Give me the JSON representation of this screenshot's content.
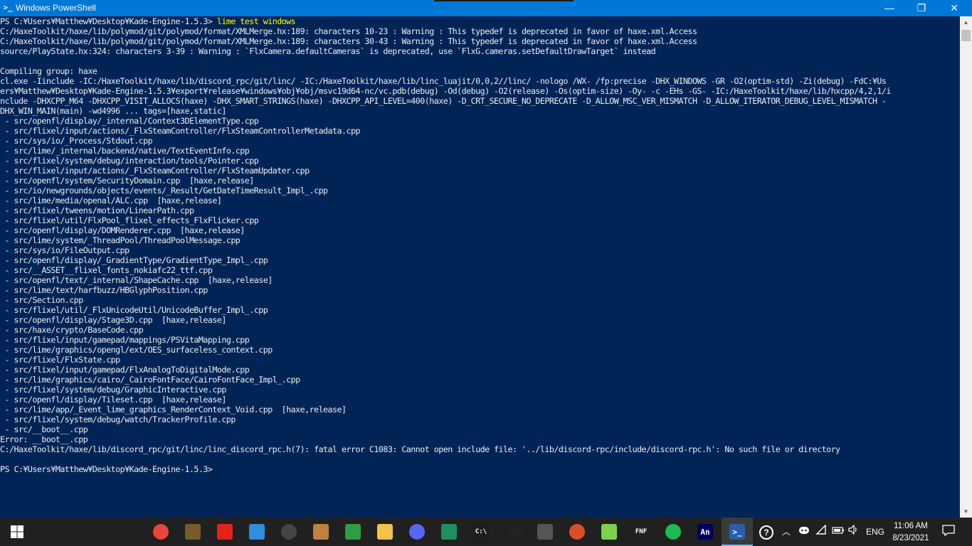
{
  "window": {
    "title": "Windows PowerShell",
    "minimize_glyph": "—",
    "maximize_glyph": "❐",
    "close_glyph": "✕",
    "app_icon_glyph": ">_"
  },
  "console": {
    "prompt": "PS C:¥Users¥Matthew¥Desktop¥Kade-Engine-1.5.3> ",
    "command": "lime test windows",
    "lines": [
      "C:/HaxeToolkit/haxe/lib/polymod/git/polymod/format/XMLMerge.hx:189: characters 10-23 : Warning : This typedef is deprecated in favor of haxe.xml.Access",
      "C:/HaxeToolkit/haxe/lib/polymod/git/polymod/format/XMLMerge.hx:189: characters 30-43 : Warning : This typedef is deprecated in favor of haxe.xml.Access",
      "source/PlayState.hx:324: characters 3-39 : Warning : `FlxCamera.defaultCameras` is deprecated, use `FlxG.cameras.setDefaultDrawTarget` instead",
      "",
      "Compiling group: haxe",
      "cl.exe -Iinclude -IC:/HaxeToolkit/haxe/lib/discord_rpc/git/linc/ -IC:/HaxeToolkit/haxe/lib/linc_luajit/0,0,2//linc/ -nologo /WX- /fp:precise -DHX_WINDOWS -GR -O2(optim-std) -Zi(debug) -FdC:¥Us",
      "ers¥Matthew¥Desktop¥Kade-Engine-1.5.3¥export¥release¥windows¥obj¥obj/msvc19d64-nc/vc.pdb(debug) -Od(debug) -O2(release) -Os(optim-size) -Oy- -c -EHs -GS- -IC:/HaxeToolkit/haxe/lib/hxcpp/4,2,1/i",
      "nclude -DHXCPP_M64 -DHXCPP_VISIT_ALLOCS(haxe) -DHX_SMART_STRINGS(haxe) -DHXCPP_API_LEVEL=400(haxe) -D_CRT_SECURE_NO_DEPRECATE -D_ALLOW_MSC_VER_MISMATCH -D_ALLOW_ITERATOR_DEBUG_LEVEL_MISMATCH -",
      "DHX_WIN_MAIN(main) -wd4996 ... tags=[haxe,static]",
      " - src/openfl/display/_internal/Context3DElementType.cpp",
      " - src/flixel/input/actions/_FlxSteamController/FlxSteamControllerMetadata.cpp",
      " - src/sys/io/_Process/Stdout.cpp",
      " - src/lime/_internal/backend/native/TextEventInfo.cpp",
      " - src/flixel/system/debug/interaction/tools/Pointer.cpp",
      " - src/flixel/input/actions/_FlxSteamController/FlxSteamUpdater.cpp",
      " - src/openfl/system/SecurityDomain.cpp  [haxe,release]",
      " - src/io/newgrounds/objects/events/_Result/GetDateTimeResult_Impl_.cpp",
      " - src/lime/media/openal/ALC.cpp  [haxe,release]",
      " - src/flixel/tweens/motion/LinearPath.cpp",
      " - src/flixel/util/FlxPool_flixel_effects_FlxFlicker.cpp",
      " - src/openfl/display/DOMRenderer.cpp  [haxe,release]",
      " - src/lime/system/_ThreadPool/ThreadPoolMessage.cpp",
      " - src/sys/io/FileOutput.cpp",
      " - src/openfl/display/_GradientType/GradientType_Impl_.cpp",
      " - src/__ASSET__flixel_fonts_nokiafc22_ttf.cpp",
      " - src/openfl/text/_internal/ShapeCache.cpp  [haxe,release]",
      " - src/lime/text/harfbuzz/HBGlyphPosition.cpp",
      " - src/Section.cpp",
      " - src/flixel/util/_FlxUnicodeUtil/UnicodeBuffer_Impl_.cpp",
      " - src/openfl/display/Stage3D.cpp  [haxe,release]",
      " - src/haxe/crypto/BaseCode.cpp",
      " - src/flixel/input/gamepad/mappings/PSVitaMapping.cpp",
      " - src/lime/graphics/opengl/ext/OES_surfaceless_context.cpp",
      " - src/flixel/FlxState.cpp",
      " - src/flixel/input/gamepad/FlxAnalogToDigitalMode.cpp",
      " - src/lime/graphics/cairo/_CairoFontFace/CairoFontFace_Impl_.cpp",
      " - src/flixel/system/debug/GraphicInteractive.cpp",
      " - src/openfl/display/Tileset.cpp  [haxe,release]",
      " - src/lime/app/_Event_lime_graphics_RenderContext_Void.cpp  [haxe,release]",
      " - src/flixel/system/debug/watch/TrackerProfile.cpp",
      " - src/__boot__.cpp",
      "Error: __boot__.cpp",
      "C:/HaxeToolkit/haxe/lib/discord_rpc/git/linc/linc_discord_rpc.h(7): fatal error C1083: Cannot open include file: '../lib/discord-rpc/include/discord-rpc.h': No such file or directory",
      "",
      "PS C:¥Users¥Matthew¥Desktop¥Kade-Engine-1.5.3>"
    ]
  },
  "taskbar": {
    "apps": [
      {
        "name": "chrome-icon",
        "label": "",
        "color": "#e8453c"
      },
      {
        "name": "minecraft-icon",
        "label": "",
        "color": "#7a5a2b"
      },
      {
        "name": "roblox-icon",
        "label": "",
        "color": "#e2231a"
      },
      {
        "name": "windows-app-icon",
        "label": "",
        "color": "#2d8de0"
      },
      {
        "name": "obs-icon",
        "label": "",
        "color": "#444444"
      },
      {
        "name": "game-character-icon",
        "label": "",
        "color": "#c08040"
      },
      {
        "name": "green-creature-icon",
        "label": "",
        "color": "#2f9e44"
      },
      {
        "name": "file-explorer-icon",
        "label": "",
        "color": "#f2c14e"
      },
      {
        "name": "discord-icon",
        "label": "",
        "color": "#5865f2"
      },
      {
        "name": "green-game-icon",
        "label": "",
        "color": "#1f8f5f"
      },
      {
        "name": "command-prompt-icon",
        "label": "C:\\",
        "color": "#1e1e1e"
      },
      {
        "name": "red-eyes-game-icon",
        "label": "",
        "color": "#222222"
      },
      {
        "name": "dark-character-icon",
        "label": "",
        "color": "#555555"
      },
      {
        "name": "round-game-icon",
        "label": "",
        "color": "#d94f2b"
      },
      {
        "name": "green-sword-icon",
        "label": "",
        "color": "#7cd34a"
      },
      {
        "name": "fnf-icon",
        "label": "FNF",
        "color": "#202020"
      },
      {
        "name": "spotify-icon",
        "label": "",
        "color": "#1db954"
      },
      {
        "name": "animate-icon",
        "label": "An",
        "color": "#00005b"
      },
      {
        "name": "powershell-icon",
        "label": ">_",
        "color": "#2a5fa8"
      }
    ],
    "tray": {
      "language": "ENG",
      "time": "11:06 AM",
      "date": "8/23/2021"
    }
  },
  "colors": {
    "console_bg": "#012456",
    "console_text": "#eeedf0",
    "command_yellow": "#ffff00",
    "titlebar": "#0078d7",
    "taskbar": "#202020"
  }
}
